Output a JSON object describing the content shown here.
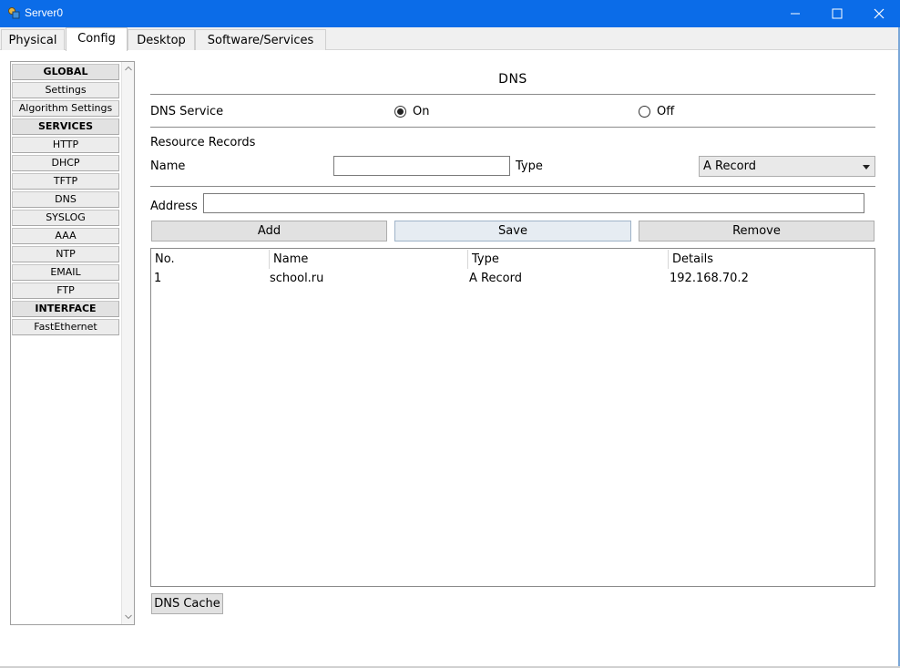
{
  "window": {
    "title": "Server0",
    "controls": [
      "minimize-icon",
      "maximize-icon",
      "close-icon"
    ],
    "accent": "#0b6ce8"
  },
  "tabs": [
    "Physical",
    "Config",
    "Desktop",
    "Software/Services"
  ],
  "active_tab": "Config",
  "sidebar": {
    "items": [
      {
        "label": "GLOBAL",
        "header": true
      },
      {
        "label": "Settings",
        "header": false
      },
      {
        "label": "Algorithm Settings",
        "header": false
      },
      {
        "label": "SERVICES",
        "header": true
      },
      {
        "label": "HTTP",
        "header": false
      },
      {
        "label": "DHCP",
        "header": false
      },
      {
        "label": "TFTP",
        "header": false
      },
      {
        "label": "DNS",
        "header": false
      },
      {
        "label": "SYSLOG",
        "header": false
      },
      {
        "label": "AAA",
        "header": false
      },
      {
        "label": "NTP",
        "header": false
      },
      {
        "label": "EMAIL",
        "header": false
      },
      {
        "label": "FTP",
        "header": false
      },
      {
        "label": "INTERFACE",
        "header": true
      },
      {
        "label": "FastEthernet",
        "header": false
      }
    ]
  },
  "dns": {
    "title": "DNS",
    "service_label": "DNS Service",
    "on_label": "On",
    "off_label": "Off",
    "service_state": "On",
    "resource_records_label": "Resource Records",
    "name_label": "Name",
    "name_value": "",
    "type_label": "Type",
    "type_value": "A Record",
    "address_label": "Address",
    "address_value": "",
    "buttons": {
      "add": "Add",
      "save": "Save",
      "remove": "Remove",
      "cache": "DNS Cache"
    },
    "table": {
      "columns": [
        "No.",
        "Name",
        "Type",
        "Details"
      ],
      "rows": [
        [
          "1",
          "school.ru",
          "A Record",
          "192.168.70.2"
        ]
      ]
    }
  }
}
